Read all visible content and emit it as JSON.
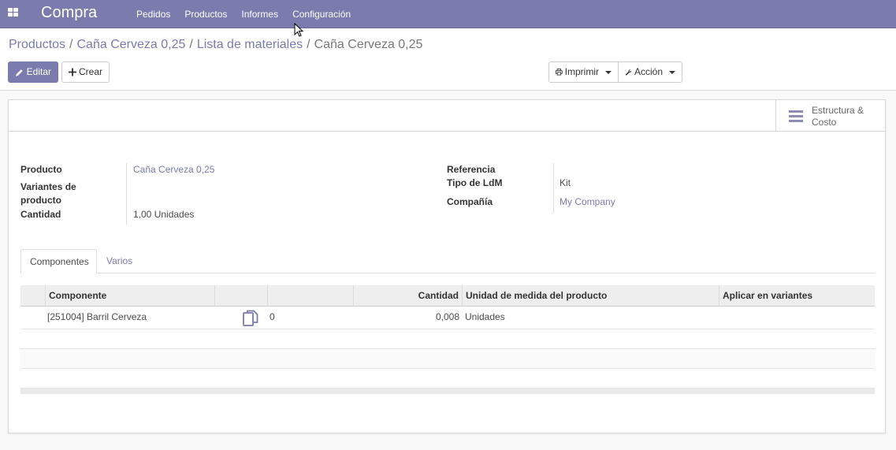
{
  "app": {
    "brand": "Compra",
    "menu": [
      "Pedidos",
      "Productos",
      "Informes",
      "Configuración"
    ],
    "accent_color": "#7c7bad"
  },
  "breadcrumb": {
    "items": [
      "Productos",
      "Caña Cerveza 0,25",
      "Lista de materiales"
    ],
    "current": "Caña Cerveza 0,25"
  },
  "toolbar": {
    "edit_label": "Editar",
    "create_label": "Crear",
    "print_label": "Imprimir",
    "action_label": "Acción"
  },
  "smart_button": {
    "label_line1": "Estructura &",
    "label_line2": "Costo",
    "icon": "bars-icon"
  },
  "form": {
    "product_label": "Producto",
    "product_value": "Caña Cerveza 0,25",
    "variants_label_1": "Variantes de",
    "variants_label_2": "producto",
    "variants_value": "",
    "quantity_label": "Cantidad",
    "quantity_value": "1,00",
    "quantity_uom": "Unidades",
    "reference_label": "Referencia",
    "reference_value": "",
    "bom_type_label": "Tipo de LdM",
    "bom_type_value": "Kit",
    "company_label": "Compañía",
    "company_value": "My Company"
  },
  "tabs": [
    "Componentes",
    "Varios"
  ],
  "table": {
    "headers": [
      "Componente",
      "",
      "",
      "Cantidad",
      "Unidad de medida del producto",
      "Aplicar en variantes"
    ],
    "rows": [
      {
        "component": "[251004] Barril Cerveza",
        "count": "0",
        "quantity": "0,008",
        "uom": "Unidades",
        "variants": ""
      }
    ]
  }
}
